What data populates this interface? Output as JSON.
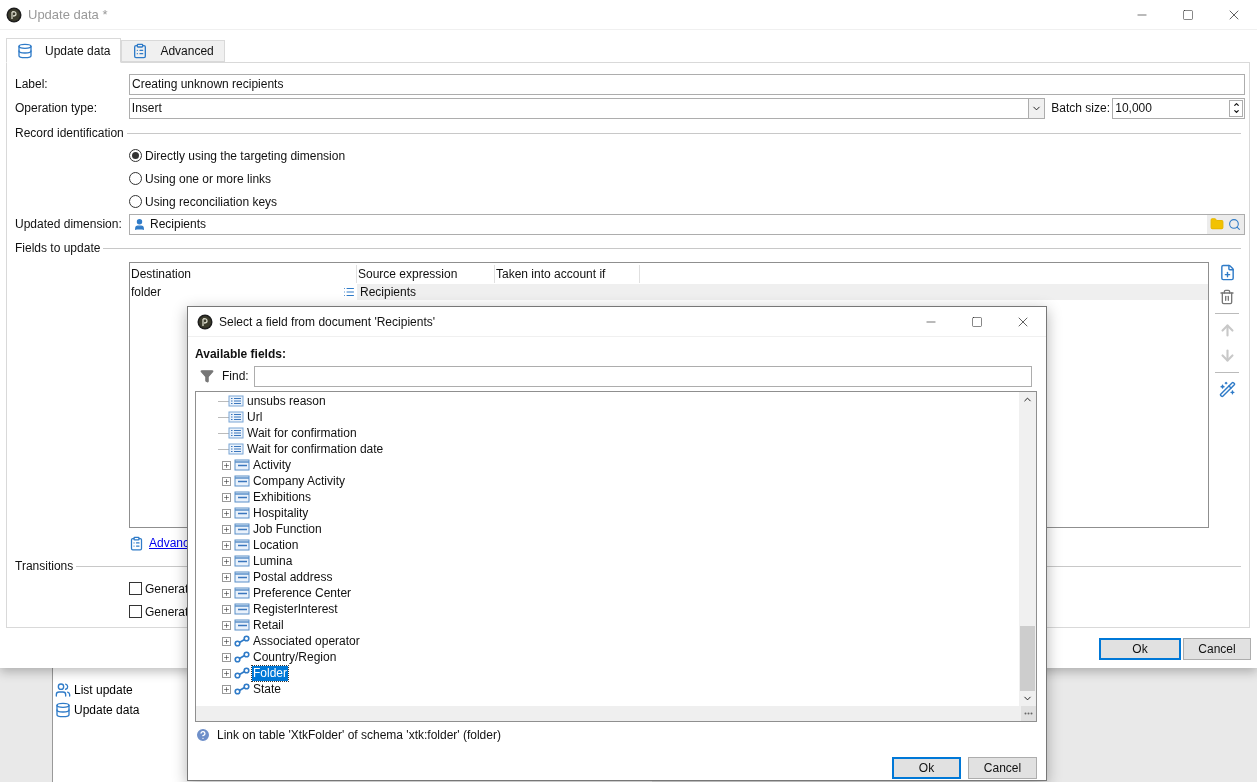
{
  "background_list": {
    "items": [
      {
        "label": "List update",
        "kind": "list"
      },
      {
        "label": "Update data",
        "kind": "data"
      }
    ]
  },
  "main_window": {
    "title": "Update data *",
    "tabs": [
      {
        "label": "Update data",
        "kind": "data",
        "selected": true
      },
      {
        "label": "Advanced",
        "kind": "clipboard",
        "selected": false
      }
    ],
    "label_field": {
      "label": "Label:",
      "value": "Creating unknown recipients"
    },
    "operation_type": {
      "label": "Operation type:",
      "value": "Insert"
    },
    "batch_size": {
      "label": "Batch size:",
      "value": "10,000"
    },
    "record_identification": {
      "heading": "Record identification",
      "options": [
        {
          "label": "Directly using the targeting dimension",
          "selected": true
        },
        {
          "label": "Using one or more links",
          "selected": false
        },
        {
          "label": "Using reconciliation keys",
          "selected": false
        }
      ]
    },
    "updated_dimension": {
      "label": "Updated dimension:",
      "value": "Recipients"
    },
    "fields_to_update": {
      "heading": "Fields to update",
      "columns": [
        "Destination",
        "Source expression",
        "Taken into account if"
      ],
      "rows": [
        {
          "destination": "folder",
          "source_expression": "Recipients",
          "selected": true
        }
      ],
      "link": "Advanc"
    },
    "transitions": {
      "heading": "Transitions",
      "options": [
        {
          "label": "Generat",
          "checked": false
        },
        {
          "label": "Generat",
          "checked": false
        }
      ]
    },
    "buttons": [
      "Ok",
      "Cancel"
    ]
  },
  "dialog": {
    "title": "Select a field from document 'Recipients'",
    "heading": "Available fields:",
    "find": {
      "label": "Find:"
    },
    "tree": [
      {
        "label": "unsubs reason",
        "kind": "field",
        "selected": false
      },
      {
        "label": "Url",
        "kind": "field",
        "selected": false
      },
      {
        "label": "Wait for confirmation",
        "kind": "field",
        "selected": false
      },
      {
        "label": "Wait for confirmation date",
        "kind": "field",
        "selected": false
      },
      {
        "label": "Activity",
        "kind": "table",
        "selected": false
      },
      {
        "label": "Company Activity",
        "kind": "table",
        "selected": false
      },
      {
        "label": "Exhibitions",
        "kind": "table",
        "selected": false
      },
      {
        "label": "Hospitality",
        "kind": "table",
        "selected": false
      },
      {
        "label": "Job Function",
        "kind": "table",
        "selected": false
      },
      {
        "label": "Location",
        "kind": "table",
        "selected": false
      },
      {
        "label": "Lumina",
        "kind": "table",
        "selected": false
      },
      {
        "label": "Postal address",
        "kind": "table",
        "selected": false
      },
      {
        "label": "Preference Center",
        "kind": "table",
        "selected": false
      },
      {
        "label": "RegisterInterest",
        "kind": "table",
        "selected": false
      },
      {
        "label": "Retail",
        "kind": "table",
        "selected": false
      },
      {
        "label": "Associated operator",
        "kind": "link",
        "selected": false
      },
      {
        "label": "Country/Region",
        "kind": "link",
        "selected": false
      },
      {
        "label": "Folder",
        "kind": "link",
        "selected": true
      },
      {
        "label": "State",
        "kind": "link",
        "selected": false
      }
    ],
    "info": "Link on table 'XtkFolder' of schema 'xtk:folder' (folder)",
    "buttons": [
      "Ok",
      "Cancel"
    ]
  }
}
